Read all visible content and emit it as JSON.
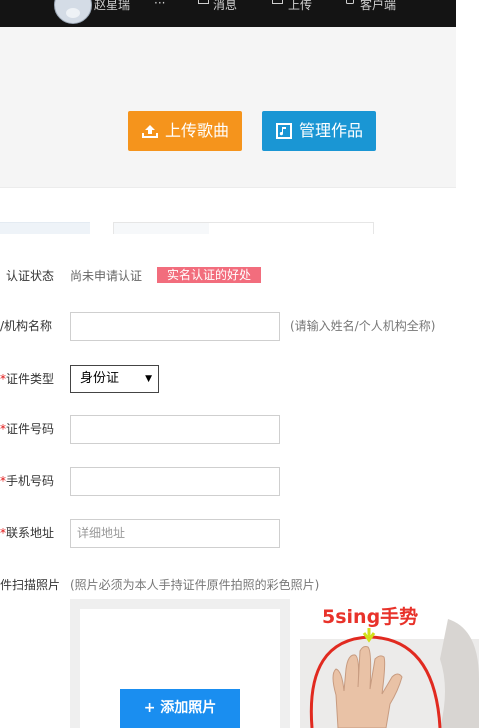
{
  "topbar": {
    "user_name": "赵星瑞",
    "more": "···",
    "messages": "消息",
    "upload": "上传",
    "mobile": "客户端"
  },
  "buttons": {
    "upload_song": "上传歌曲",
    "manage_works": "管理作品"
  },
  "form": {
    "status": {
      "label": "认证状态",
      "value": "尚未申请认证",
      "badge": "实名认证的好处"
    },
    "name": {
      "label": "/机构名称",
      "value": "",
      "hint": "(请输入姓名/个人机构全称)"
    },
    "id_type": {
      "required": "*",
      "label": "证件类型",
      "selected": "身份证"
    },
    "id_number": {
      "required": "*",
      "label": "证件号码",
      "value": ""
    },
    "phone": {
      "required": "*",
      "label": "手机号码",
      "value": ""
    },
    "address": {
      "required": "*",
      "label": "联系地址",
      "placeholder": "详细地址"
    },
    "photo": {
      "label": "件扫描照片",
      "hint": "(照片必须为本人手持证件原件拍照的彩色照片)",
      "add_button": "+ 添加照片",
      "sample_title": "5sing手势"
    }
  },
  "colors": {
    "topbar": "#141414",
    "upload_button": "#f5941c",
    "manage_button": "#1a96d4",
    "badge": "#f26d7d",
    "add_button": "#1a8ef0",
    "required": "#e21818"
  }
}
